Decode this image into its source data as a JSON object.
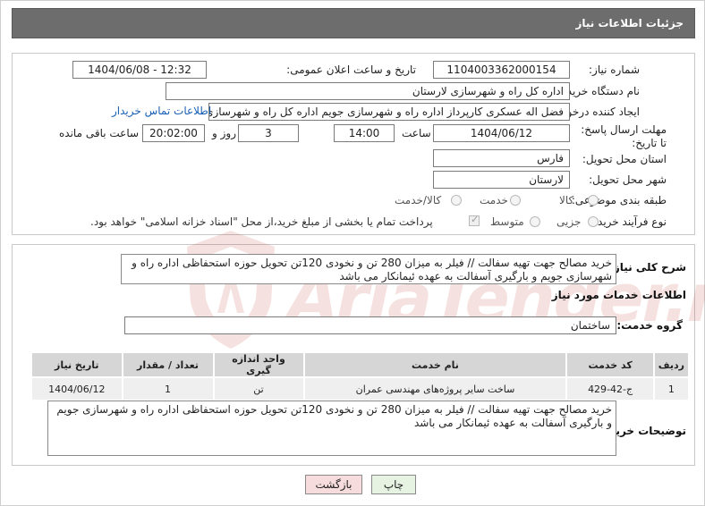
{
  "header": {
    "title": "جزئیات اطلاعات نیاز"
  },
  "form": {
    "need_number_label": "شماره نیاز:",
    "need_number": "1104003362000154",
    "announce_label": "تاریخ و ساعت اعلان عمومی:",
    "announce_value": "1404/06/08 - 12:32",
    "buyer_org_label": "نام دستگاه خریدار:",
    "buyer_org": "اداره کل راه و شهرسازی لارستان",
    "requester_label": "ایجاد کننده درخواست:",
    "requester": "فضل اله عسکری کارپرداز اداره راه و شهرسازی جویم اداره کل راه و شهرسازی لا",
    "contact_link": "اطلاعات تماس خریدار",
    "deadline_label": "مهلت ارسال پاسخ: تا تاریخ:",
    "deadline_date": "1404/06/12",
    "time_label": "ساعت",
    "deadline_time": "14:00",
    "days_value": "3",
    "days_label": "روز و",
    "remaining_time": "20:02:00",
    "remaining_label": "ساعت باقی مانده",
    "province_label": "استان محل تحویل:",
    "province": "فارس",
    "city_label": "شهر محل تحویل:",
    "city": "لارستان",
    "category_label": "طبقه بندی موضوعی:",
    "category_options": [
      "کالا",
      "خدمت",
      "کالا/خدمت"
    ],
    "process_label": "نوع فرآیند خرید :",
    "process_options": [
      "جزیی",
      "متوسط"
    ],
    "payment_note": "پرداخت تمام یا بخشی از مبلغ خرید،از محل \"اسناد خزانه اسلامی\" خواهد بود."
  },
  "summary": {
    "label": "شرح کلی نیاز:",
    "text": "خرید مصالح جهت تهیه سفالت // فیلر به میزان 280 تن و نخودی 120تن تحویل حوزه استحفاظی اداره راه و شهرسازی جویم و بارگیری آسفالت به عهده ئیمانکار می باشد"
  },
  "services": {
    "section_title": "اطلاعات خدمات مورد نیاز",
    "group_label": "گروه خدمت:",
    "group_value": "ساختمان",
    "columns": [
      "ردیف",
      "کد خدمت",
      "نام خدمت",
      "واحد اندازه گیری",
      "تعداد / مقدار",
      "تاریخ نیاز"
    ],
    "rows": [
      [
        "1",
        "ج-42-429",
        "ساخت سایر پروژه‌های مهندسی عمران",
        "تن",
        "1",
        "1404/06/12"
      ]
    ]
  },
  "buyer_notes": {
    "label": "توضیحات خریدار:",
    "text": "خرید مصالح جهت تهیه سفالت // فیلر به میزان 280 تن و نخودی 120تن تحویل حوزه استحفاظی اداره راه و شهرسازی جویم و بارگیری آسفالت به عهده ئیمانکار می باشد"
  },
  "buttons": {
    "print": "چاپ",
    "back": "بازگشت"
  },
  "watermark": {
    "text": "AriaTender.neT"
  }
}
